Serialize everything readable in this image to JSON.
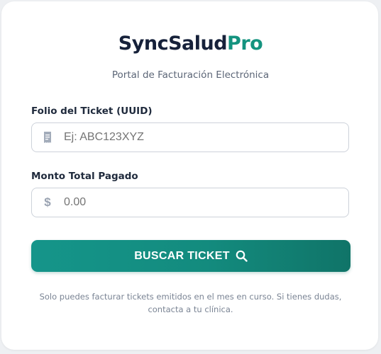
{
  "brand": {
    "name_main": "SyncSalud",
    "name_accent": "Pro",
    "accent_color": "#14937f",
    "subtitle": "Portal de Facturación Electrónica"
  },
  "form": {
    "folio": {
      "label": "Folio del Ticket (UUID)",
      "placeholder": "Ej: ABC123XYZ",
      "value": "",
      "icon": "receipt-icon"
    },
    "monto": {
      "label": "Monto Total Pagado",
      "placeholder": "0.00",
      "value": "",
      "icon_text": "$"
    },
    "submit": {
      "label": "BUSCAR TICKET",
      "icon": "search-icon",
      "color": "#138b7e"
    }
  },
  "footnote": "Solo puedes facturar tickets emitidos en el mes en curso. Si tienes dudas, contacta a tu clínica."
}
